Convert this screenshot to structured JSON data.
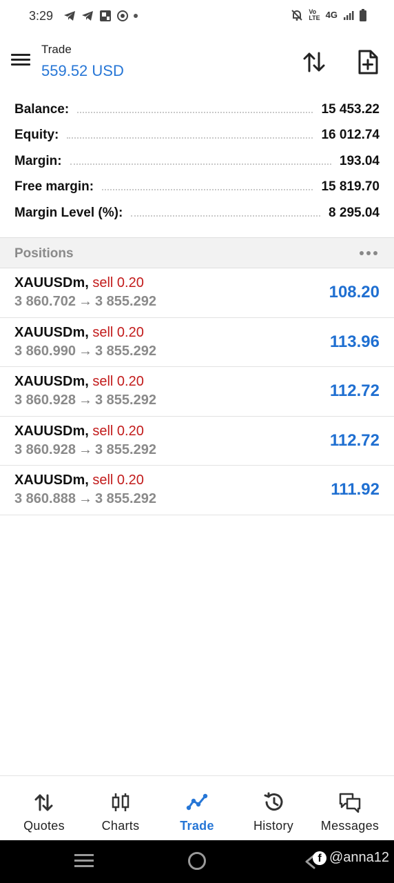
{
  "status_bar": {
    "time": "3:29",
    "network_label": "4G",
    "volte_label": "VoLTE",
    "icons": [
      "telegram-icon",
      "telegram-icon",
      "photo-icon",
      "recorder-icon",
      "dot-icon",
      "bell-off-icon",
      "volte-icon",
      "network-4g-icon",
      "signal-icon",
      "battery-icon"
    ]
  },
  "header": {
    "title": "Trade",
    "subtitle": "559.52 USD",
    "icons": [
      "menu-icon",
      "sort-icon",
      "new-order-icon"
    ]
  },
  "summary": [
    {
      "label": "Balance:",
      "value": "15 453.22"
    },
    {
      "label": "Equity:",
      "value": "16 012.74"
    },
    {
      "label": "Margin:",
      "value": "193.04"
    },
    {
      "label": "Free margin:",
      "value": "15 819.70"
    },
    {
      "label": "Margin Level (%):",
      "value": "8 295.04"
    }
  ],
  "positions_section": {
    "title": "Positions"
  },
  "positions": [
    {
      "symbol": "XAUUSDm,",
      "side": "sell 0.20",
      "open_price": "3 860.702",
      "arrow": "→",
      "current_price": "3 855.292",
      "profit": "108.20"
    },
    {
      "symbol": "XAUUSDm,",
      "side": "sell 0.20",
      "open_price": "3 860.990",
      "arrow": "→",
      "current_price": "3 855.292",
      "profit": "113.96"
    },
    {
      "symbol": "XAUUSDm,",
      "side": "sell 0.20",
      "open_price": "3 860.928",
      "arrow": "→",
      "current_price": "3 855.292",
      "profit": "112.72"
    },
    {
      "symbol": "XAUUSDm,",
      "side": "sell 0.20",
      "open_price": "3 860.928",
      "arrow": "→",
      "current_price": "3 855.292",
      "profit": "112.72"
    },
    {
      "symbol": "XAUUSDm,",
      "side": "sell 0.20",
      "open_price": "3 860.888",
      "arrow": "→",
      "current_price": "3 855.292",
      "profit": "111.92"
    }
  ],
  "bottom_nav": [
    {
      "label": "Quotes",
      "icon": "quotes-icon",
      "active": false
    },
    {
      "label": "Charts",
      "icon": "charts-icon",
      "active": false
    },
    {
      "label": "Trade",
      "icon": "trade-icon",
      "active": true
    },
    {
      "label": "History",
      "icon": "history-icon",
      "active": false
    },
    {
      "label": "Messages",
      "icon": "messages-icon",
      "active": false
    }
  ],
  "watermark": {
    "text": "@anna12"
  },
  "colors": {
    "accent": "#2676d6",
    "profit": "#1f6fd1",
    "sell": "#c21b1b",
    "muted": "#8a8a8a"
  }
}
